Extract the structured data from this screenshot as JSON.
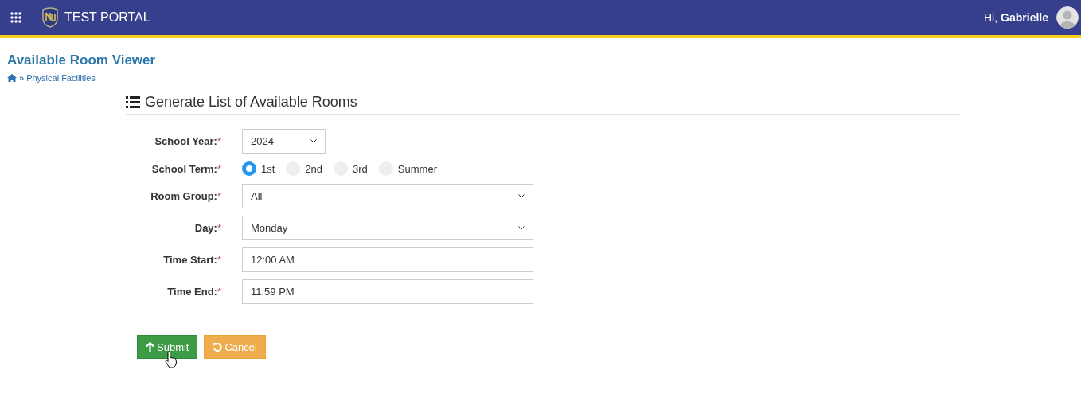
{
  "header": {
    "app_name": "TEST PORTAL",
    "greeting": "Hi,",
    "user_name": "Gabrielle"
  },
  "page": {
    "title": "Available Room Viewer",
    "breadcrumb": [
      {
        "label": "»",
        "kind": "separator"
      },
      {
        "label": "Physical Facilities",
        "kind": "link"
      }
    ]
  },
  "form": {
    "title": "Generate List of Available Rooms",
    "fields": [
      {
        "kind": "compact_select",
        "label": "School Year:",
        "mark": "*",
        "value": "2024"
      },
      {
        "kind": "radio",
        "label": "School Term:",
        "mark": "*",
        "options": [
          {
            "label": "1st",
            "selected": true
          },
          {
            "label": "2nd",
            "selected": false
          },
          {
            "label": "3rd",
            "selected": false
          },
          {
            "label": "Summer",
            "selected": false
          }
        ]
      },
      {
        "kind": "select",
        "label": "Room Group:",
        "mark": "*",
        "value": "All"
      },
      {
        "kind": "select",
        "label": "Day:",
        "mark": "*",
        "value": "Monday"
      },
      {
        "kind": "text",
        "label": "Time Start:",
        "mark": "*",
        "value": "12:00 AM"
      },
      {
        "kind": "text",
        "label": "Time End:",
        "mark": "*",
        "value": "11:59 PM"
      }
    ],
    "buttons": [
      {
        "label": "Submit",
        "kind": "submit"
      },
      {
        "label": "Cancel",
        "kind": "cancel"
      }
    ]
  }
}
